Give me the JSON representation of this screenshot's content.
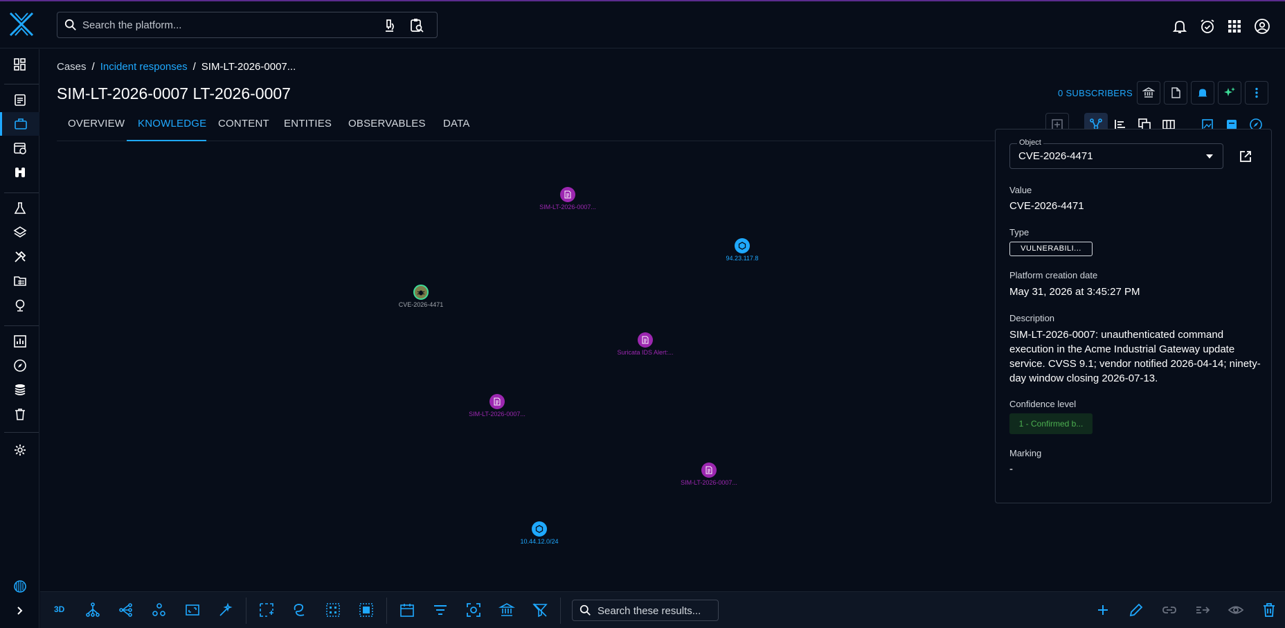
{
  "header": {
    "search_placeholder": "Search the platform..."
  },
  "breadcrumb": {
    "items": [
      "Cases",
      "Incident responses",
      "SIM-LT-2026-0007..."
    ],
    "separator": "/"
  },
  "page": {
    "title": "SIM-LT-2026-0007 LT-2026-0007",
    "subscribers": "0 SUBSCRIBERS"
  },
  "tabs": [
    {
      "label": "OVERVIEW"
    },
    {
      "label": "KNOWLEDGE"
    },
    {
      "label": "CONTENT"
    },
    {
      "label": "ENTITIES"
    },
    {
      "label": "OBSERVABLES"
    },
    {
      "label": "DATA"
    }
  ],
  "graph": {
    "nodes": [
      {
        "label": "SIM-LT-2026-0007...",
        "kind": "report",
        "color": "#9c27b0"
      },
      {
        "label": "94.23.117.8",
        "kind": "ip",
        "color": "#1fa9ff"
      },
      {
        "label": "CVE-2026-4471",
        "kind": "vulnerability",
        "color": "#7a7d4a"
      },
      {
        "label": "Suricata IDS Alert:...",
        "kind": "report",
        "color": "#9c27b0"
      },
      {
        "label": "SIM-LT-2026-0007...",
        "kind": "report",
        "color": "#9c27b0"
      },
      {
        "label": "SIM-LT-2026-0007...",
        "kind": "report",
        "color": "#9c27b0"
      },
      {
        "label": "10.44.12.0/24",
        "kind": "ip",
        "color": "#1fa9ff"
      }
    ]
  },
  "panel": {
    "object_legend": "Object",
    "object_value": "CVE-2026-4471",
    "value_label": "Value",
    "value": "CVE-2026-4471",
    "type_label": "Type",
    "type": "VULNERABILI...",
    "creation_label": "Platform creation date",
    "creation": "May 31, 2026 at 3:45:27 PM",
    "description_label": "Description",
    "description": "SIM-LT-2026-0007: unauthenticated command execution in the Acme Industrial Gateway update service. CVSS 9.1; vendor notified 2026-04-14; ninety-day window closing 2026-07-13.",
    "confidence_label": "Confidence level",
    "confidence": "1 - Confirmed b...",
    "marking_label": "Marking",
    "marking": "-"
  },
  "bottombar": {
    "mode_3d": "3D",
    "search_placeholder": "Search these results..."
  },
  "colors": {
    "accent": "#1fa9ff",
    "report": "#9c27b0",
    "confidence": "#4caf50"
  }
}
